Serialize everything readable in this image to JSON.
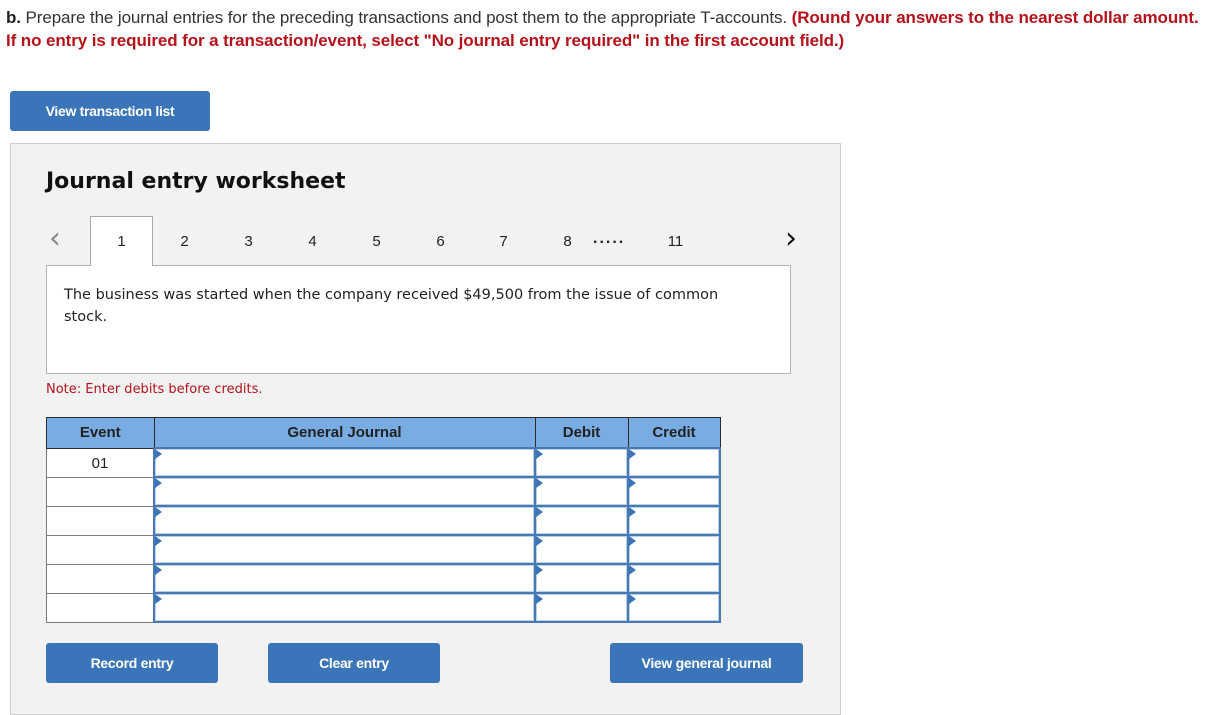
{
  "instructions": {
    "part_label": "b.",
    "text": " Prepare the journal entries for the preceding transactions and post them to the appropriate T-accounts. ",
    "emphasis": "(Round your answers to the nearest dollar amount. If no entry is required for a transaction/event, select \"No journal entry required\" in the first account field.)"
  },
  "buttons": {
    "view_transaction_list": "View transaction list",
    "record_entry": "Record entry",
    "clear_entry": "Clear entry",
    "view_general_journal": "View general journal"
  },
  "worksheet": {
    "title": "Journal entry worksheet",
    "prev_icon": "chevron-left-icon",
    "next_icon": "chevron-right-icon",
    "tabs": [
      "1",
      "2",
      "3",
      "4",
      "5",
      "6",
      "7",
      "8",
      "11"
    ],
    "ellipsis": ".....",
    "active_tab": "1",
    "description": "The business was started when the company received $49,500 from the issue of common stock.",
    "note": "Note: Enter debits before credits."
  },
  "journal": {
    "headers": {
      "event": "Event",
      "general_journal": "General Journal",
      "debit": "Debit",
      "credit": "Credit"
    },
    "rows": [
      {
        "event": "01",
        "account": "",
        "debit": "",
        "credit": ""
      },
      {
        "event": "",
        "account": "",
        "debit": "",
        "credit": ""
      },
      {
        "event": "",
        "account": "",
        "debit": "",
        "credit": ""
      },
      {
        "event": "",
        "account": "",
        "debit": "",
        "credit": ""
      },
      {
        "event": "",
        "account": "",
        "debit": "",
        "credit": ""
      },
      {
        "event": "",
        "account": "",
        "debit": "",
        "credit": ""
      }
    ]
  },
  "colors": {
    "accent": "#3b75b9",
    "header": "#79ace3",
    "warning": "#b5121b"
  }
}
